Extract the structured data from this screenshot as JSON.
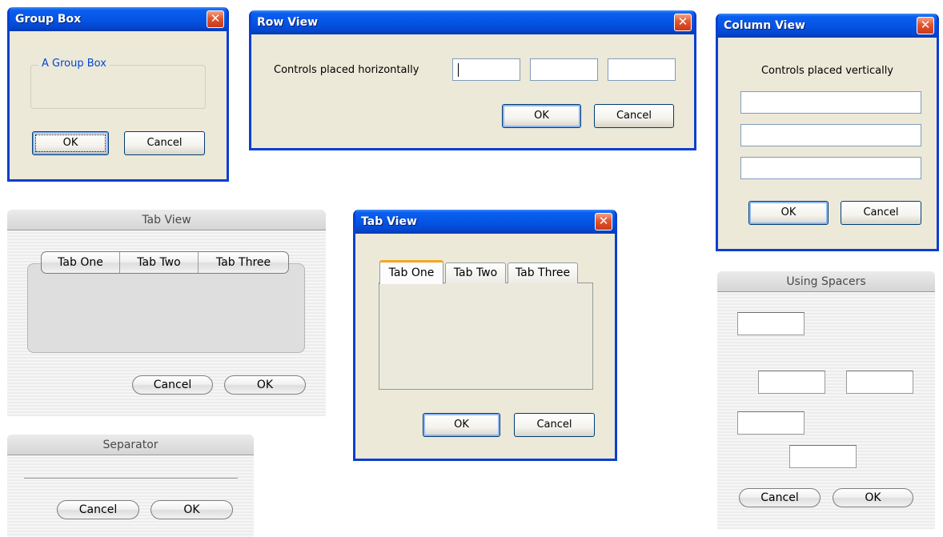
{
  "group_box_window": {
    "title": "Group Box",
    "group_label": "A Group Box",
    "ok_label": "OK",
    "cancel_label": "Cancel"
  },
  "row_view_window": {
    "title": "Row View",
    "label": "Controls placed horizontally",
    "fields": [
      "",
      "",
      ""
    ],
    "ok_label": "OK",
    "cancel_label": "Cancel"
  },
  "column_view_window": {
    "title": "Column View",
    "label": "Controls placed vertically",
    "fields": [
      "",
      "",
      ""
    ],
    "ok_label": "OK",
    "cancel_label": "Cancel"
  },
  "mac_tab_view_window": {
    "title": "Tab View",
    "tabs": [
      "Tab One",
      "Tab Two",
      "Tab Three"
    ],
    "cancel_label": "Cancel",
    "ok_label": "OK"
  },
  "xp_tab_view_window": {
    "title": "Tab View",
    "tabs": [
      "Tab One",
      "Tab Two",
      "Tab Three"
    ],
    "ok_label": "OK",
    "cancel_label": "Cancel"
  },
  "separator_window": {
    "title": "Separator",
    "cancel_label": "Cancel",
    "ok_label": "OK"
  },
  "spacers_window": {
    "title": "Using Spacers",
    "cancel_label": "Cancel",
    "ok_label": "OK"
  },
  "icons": {
    "close": "close-icon"
  },
  "colors": {
    "xp_titlebar": "#0553e3",
    "xp_face": "#ece9d8",
    "xp_close": "#e2552f",
    "group_label": "#0046d5",
    "xp_selected_tab_accent": "#f5a623",
    "mac_face": "#ececec"
  }
}
